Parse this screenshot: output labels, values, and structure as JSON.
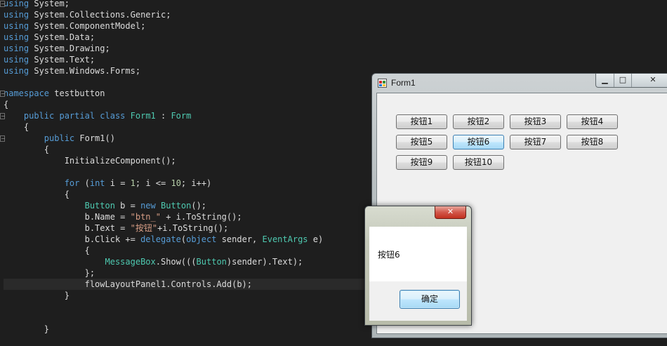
{
  "editor": {
    "lines": [
      [
        [
          "kw",
          "using"
        ],
        [
          "txt",
          " System;"
        ]
      ],
      [
        [
          "kw",
          "using"
        ],
        [
          "txt",
          " System.Collections.Generic;"
        ]
      ],
      [
        [
          "kw",
          "using"
        ],
        [
          "txt",
          " System.ComponentModel;"
        ]
      ],
      [
        [
          "kw",
          "using"
        ],
        [
          "txt",
          " System.Data;"
        ]
      ],
      [
        [
          "kw",
          "using"
        ],
        [
          "txt",
          " System.Drawing;"
        ]
      ],
      [
        [
          "kw",
          "using"
        ],
        [
          "txt",
          " System.Text;"
        ]
      ],
      [
        [
          "kw",
          "using"
        ],
        [
          "txt",
          " System.Windows.Forms;"
        ]
      ],
      [],
      [
        [
          "kw",
          "namespace"
        ],
        [
          "txt",
          " testbutton"
        ]
      ],
      [
        [
          "txt",
          "{"
        ]
      ],
      [
        [
          "g",
          "    "
        ],
        [
          "kw",
          "public partial class"
        ],
        [
          "txt",
          " "
        ],
        [
          "type",
          "Form1"
        ],
        [
          "txt",
          " : "
        ],
        [
          "type",
          "Form"
        ]
      ],
      [
        [
          "g",
          "    "
        ],
        [
          "txt",
          "{"
        ]
      ],
      [
        [
          "g",
          "        "
        ],
        [
          "kw",
          "public"
        ],
        [
          "txt",
          " Form1()"
        ]
      ],
      [
        [
          "g",
          "        "
        ],
        [
          "txt",
          "{"
        ]
      ],
      [
        [
          "g",
          "            "
        ],
        [
          "txt",
          "InitializeComponent();"
        ]
      ],
      [],
      [
        [
          "g",
          "            "
        ],
        [
          "kw",
          "for"
        ],
        [
          "txt",
          " ("
        ],
        [
          "kw",
          "int"
        ],
        [
          "txt",
          " i = "
        ],
        [
          "num",
          "1"
        ],
        [
          "txt",
          "; i <= "
        ],
        [
          "num",
          "10"
        ],
        [
          "txt",
          "; i++)"
        ]
      ],
      [
        [
          "g",
          "            "
        ],
        [
          "txt",
          "{"
        ]
      ],
      [
        [
          "g",
          "                "
        ],
        [
          "type",
          "Button"
        ],
        [
          "txt",
          " b = "
        ],
        [
          "kw",
          "new"
        ],
        [
          "txt",
          " "
        ],
        [
          "type",
          "Button"
        ],
        [
          "txt",
          "();"
        ]
      ],
      [
        [
          "g",
          "                "
        ],
        [
          "txt",
          "b.Name = "
        ],
        [
          "str",
          "\"btn_\""
        ],
        [
          "txt",
          " + i.ToString();"
        ]
      ],
      [
        [
          "g",
          "                "
        ],
        [
          "txt",
          "b.Text = "
        ],
        [
          "str",
          "\"按钮\""
        ],
        [
          "txt",
          "+i.ToString();"
        ]
      ],
      [
        [
          "g",
          "                "
        ],
        [
          "txt",
          "b.Click += "
        ],
        [
          "kw",
          "delegate"
        ],
        [
          "txt",
          "("
        ],
        [
          "kw",
          "object"
        ],
        [
          "txt",
          " sender, "
        ],
        [
          "type",
          "EventArgs"
        ],
        [
          "txt",
          " e)"
        ]
      ],
      [
        [
          "g",
          "                "
        ],
        [
          "txt",
          "{"
        ]
      ],
      [
        [
          "g",
          "                    "
        ],
        [
          "type",
          "MessageBox"
        ],
        [
          "txt",
          ".Show((("
        ],
        [
          "type",
          "Button"
        ],
        [
          "txt",
          ")sender).Text);"
        ]
      ],
      [
        [
          "g",
          "                "
        ],
        [
          "txt",
          "};"
        ]
      ],
      [
        [
          "g",
          "                "
        ],
        [
          "txt",
          "flowLayoutPanel1.Controls.Add(b);"
        ]
      ],
      [
        [
          "g",
          "            "
        ],
        [
          "txt",
          "}"
        ]
      ],
      [],
      [],
      [
        [
          "g",
          "        "
        ],
        [
          "txt",
          "}"
        ]
      ]
    ]
  },
  "form": {
    "title": "Form1",
    "min_glyph": "▁",
    "max_glyph": "□",
    "close_glyph": "✕",
    "buttons": [
      "按钮1",
      "按钮2",
      "按钮3",
      "按钮4",
      "按钮5",
      "按钮6",
      "按钮7",
      "按钮8",
      "按钮9",
      "按钮10"
    ],
    "focused_button": "按钮6"
  },
  "messagebox": {
    "close_glyph": "✕",
    "text": "按钮6",
    "ok_label": "确定"
  }
}
